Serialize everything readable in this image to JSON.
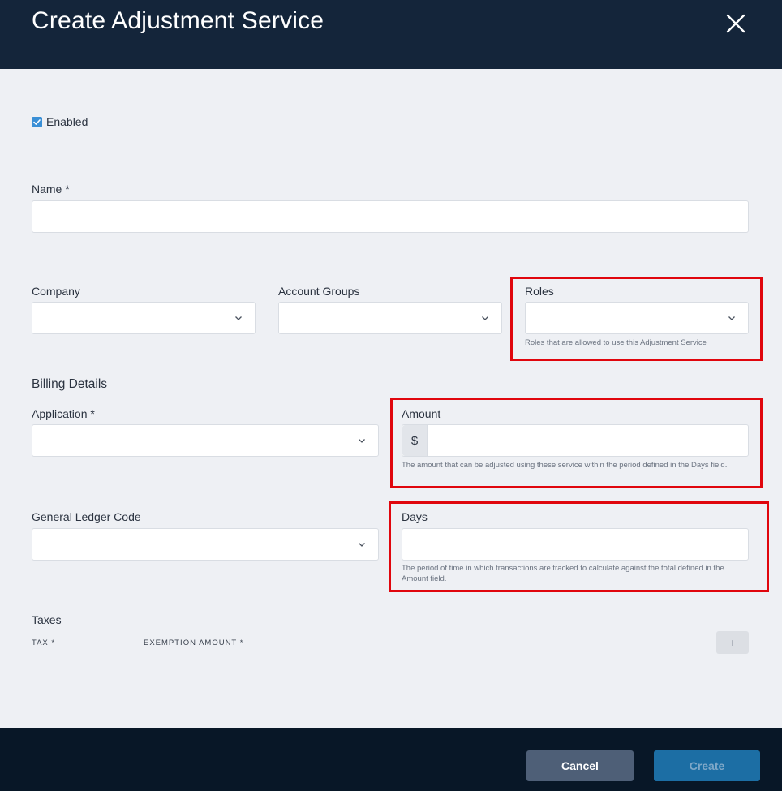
{
  "header": {
    "title": "Create Adjustment Service"
  },
  "enabled": {
    "label": "Enabled",
    "checked": true
  },
  "name": {
    "label": "Name *",
    "value": ""
  },
  "company": {
    "label": "Company",
    "value": ""
  },
  "account_groups": {
    "label": "Account Groups",
    "value": ""
  },
  "roles": {
    "label": "Roles",
    "value": "",
    "help": "Roles that are allowed to use this Adjustment Service"
  },
  "billing": {
    "title": "Billing Details"
  },
  "application": {
    "label": "Application *",
    "value": ""
  },
  "amount": {
    "label": "Amount",
    "prefix": "$",
    "value": "",
    "help": "The amount that can be adjusted using these service within the period defined in the Days field."
  },
  "gl_code": {
    "label": "General Ledger Code",
    "value": ""
  },
  "days": {
    "label": "Days",
    "value": "",
    "help": "The period of time in which transactions are tracked to calculate against the total defined in the Amount field."
  },
  "taxes": {
    "title": "Taxes",
    "col_tax": "TAX *",
    "col_exemption": "EXEMPTION AMOUNT *",
    "add_label": "+"
  },
  "footer": {
    "cancel_label": "Cancel",
    "create_label": "Create"
  },
  "colors": {
    "header_bg": "#14253a",
    "footer_bg": "#081727",
    "highlight": "#e0060d",
    "accent": "#3a8fd6"
  }
}
